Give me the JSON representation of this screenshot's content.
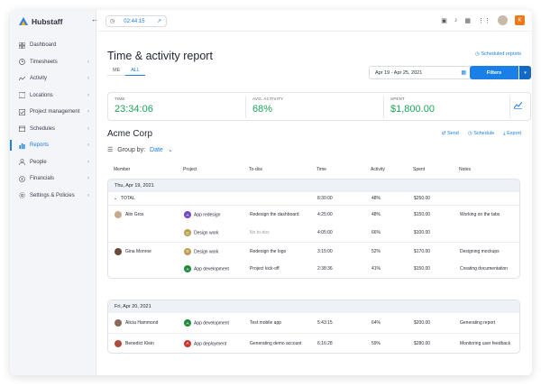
{
  "app": {
    "name": "Hubstaff"
  },
  "sidebar": {
    "items": [
      {
        "label": "Dashboard",
        "icon": "grid-icon"
      },
      {
        "label": "Timesheets",
        "icon": "clock-icon",
        "chevron": true
      },
      {
        "label": "Activity",
        "icon": "activity-icon",
        "chevron": true
      },
      {
        "label": "Locations",
        "icon": "map-icon",
        "chevron": true
      },
      {
        "label": "Project management",
        "icon": "check-icon",
        "chevron": true
      },
      {
        "label": "Schedules",
        "icon": "calendar-icon",
        "chevron": true
      },
      {
        "label": "Reports",
        "icon": "chart-icon",
        "chevron": true,
        "active": true
      },
      {
        "label": "People",
        "icon": "people-icon",
        "chevron": true
      },
      {
        "label": "Financials",
        "icon": "dollar-icon",
        "chevron": true
      },
      {
        "label": "Settings & Policies",
        "icon": "gear-icon",
        "chevron": true
      }
    ]
  },
  "topbar": {
    "timer": "02:44:15"
  },
  "header": {
    "title": "Time & activity report",
    "scheduled_reports": "Scheduled reports",
    "tabs": [
      "ME",
      "ALL"
    ],
    "active_tab": "ALL",
    "date_range": "Apr 19 - Apr 25, 2021",
    "filters": "Filters"
  },
  "stats": [
    {
      "label": "TIME",
      "value": "23:34:06"
    },
    {
      "label": "AVG. ACTIVITY",
      "value": "68%"
    },
    {
      "label": "SPENT",
      "value": "$1,800.00"
    }
  ],
  "company": "Acme Corp",
  "actions": {
    "send": "Send",
    "schedule": "Schedule",
    "export": "Export"
  },
  "groupby": {
    "label": "Group by:",
    "value": "Date"
  },
  "columns": [
    "Member",
    "Project",
    "To-dos",
    "Time",
    "Activity",
    "Spent",
    "Notes"
  ],
  "groups": [
    {
      "date": "Thu, Apr 19, 2021",
      "total": {
        "label": "TOTAL",
        "time": "8:30:00",
        "activity": "48%",
        "spent": "$250.00"
      },
      "rows": [
        {
          "member": "Alin Gros",
          "badge": "A",
          "project": "App redesign",
          "todo": "Redesign the dashboard",
          "time": "4:25:00",
          "activity": "48%",
          "spent": "$150.00",
          "notes": "Working on the tabs"
        },
        {
          "member": "",
          "badge": "D",
          "project": "Design work",
          "todo": "No to-dos",
          "time": "4:05:00",
          "activity": "66%",
          "spent": "$100.00",
          "notes": ""
        },
        {
          "member": "Gina Monroe",
          "badge": "D",
          "project": "Design work",
          "todo": "Redesign the logo",
          "time": "3:15:00",
          "activity": "52%",
          "spent": "$170.00",
          "notes": "Designing mockups"
        },
        {
          "member": "",
          "badge": "A",
          "project": "App development",
          "todo": "Project kick-off",
          "time": "2:38:36",
          "activity": "41%",
          "spent": "$150.00",
          "notes": "Creating documentation"
        }
      ]
    },
    {
      "date": "Fri, Apr 20, 2021",
      "rows": [
        {
          "member": "Alicia Hammond",
          "badge": "A",
          "project": "App development",
          "todo": "Test mobile app",
          "time": "5:43:15",
          "activity": "64%",
          "spent": "$200.00",
          "notes": "Generating report"
        },
        {
          "member": "Benedict Klein",
          "badge": "A",
          "project": "App deployment",
          "todo": "Generating demo account",
          "time": "6:16:28",
          "activity": "59%",
          "spent": "$280.00",
          "notes": "Monitoring user feedback"
        }
      ]
    }
  ]
}
